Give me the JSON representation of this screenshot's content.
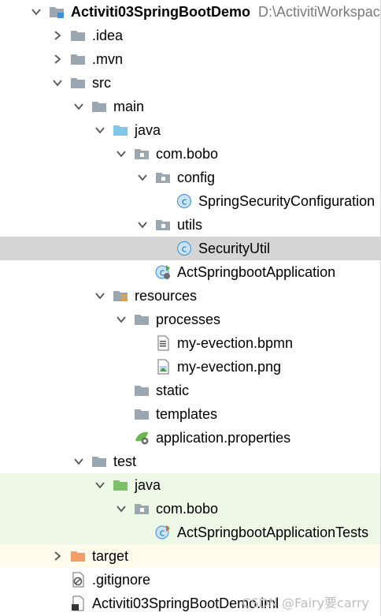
{
  "project": {
    "name": "Activiti03SpringBootDemo",
    "path": "D:\\ActivitiWorkspac"
  },
  "tree": [
    {
      "label": "Activiti03SpringBootDemo",
      "indent": 0,
      "arrow": "down",
      "icon": "module-folder-icon",
      "bold": true
    },
    {
      "label": ".idea",
      "indent": 1,
      "arrow": "right",
      "icon": "folder-icon"
    },
    {
      "label": ".mvn",
      "indent": 1,
      "arrow": "right",
      "icon": "folder-icon"
    },
    {
      "label": "src",
      "indent": 1,
      "arrow": "down",
      "icon": "folder-icon"
    },
    {
      "label": "main",
      "indent": 2,
      "arrow": "down",
      "icon": "folder-icon"
    },
    {
      "label": "java",
      "indent": 3,
      "arrow": "down",
      "icon": "source-folder-icon"
    },
    {
      "label": "com.bobo",
      "indent": 4,
      "arrow": "down",
      "icon": "package-icon"
    },
    {
      "label": "config",
      "indent": 5,
      "arrow": "down",
      "icon": "package-icon"
    },
    {
      "label": "SpringSecurityConfiguration",
      "indent": 6,
      "arrow": "none",
      "icon": "class-icon"
    },
    {
      "label": "utils",
      "indent": 5,
      "arrow": "down",
      "icon": "package-icon"
    },
    {
      "label": "SecurityUtil",
      "indent": 6,
      "arrow": "none",
      "icon": "class-icon",
      "selected": true
    },
    {
      "label": "ActSpringbootApplication",
      "indent": 5,
      "arrow": "none",
      "icon": "spring-boot-class-icon"
    },
    {
      "label": "resources",
      "indent": 3,
      "arrow": "down",
      "icon": "resources-folder-icon"
    },
    {
      "label": "processes",
      "indent": 4,
      "arrow": "down",
      "icon": "folder-icon"
    },
    {
      "label": "my-evection.bpmn",
      "indent": 5,
      "arrow": "none",
      "icon": "text-file-icon"
    },
    {
      "label": "my-evection.png",
      "indent": 5,
      "arrow": "none",
      "icon": "image-file-icon"
    },
    {
      "label": "static",
      "indent": 4,
      "arrow": "none",
      "icon": "folder-icon"
    },
    {
      "label": "templates",
      "indent": 4,
      "arrow": "none",
      "icon": "folder-icon"
    },
    {
      "label": "application.properties",
      "indent": 4,
      "arrow": "none",
      "icon": "spring-properties-icon"
    },
    {
      "label": "test",
      "indent": 2,
      "arrow": "down",
      "icon": "folder-icon"
    },
    {
      "label": "java",
      "indent": 3,
      "arrow": "down",
      "icon": "test-source-folder-icon",
      "test": true
    },
    {
      "label": "com.bobo",
      "indent": 4,
      "arrow": "down",
      "icon": "package-icon",
      "test": true
    },
    {
      "label": "ActSpringbootApplicationTests",
      "indent": 5,
      "arrow": "none",
      "icon": "spring-boot-test-class-icon",
      "test": true
    },
    {
      "label": "target",
      "indent": 1,
      "arrow": "right",
      "icon": "excluded-folder-icon",
      "ignored": true
    },
    {
      "label": ".gitignore",
      "indent": 1,
      "arrow": "none",
      "icon": "gitignore-file-icon"
    },
    {
      "label": "Activiti03SpringBootDemo.iml",
      "indent": 1,
      "arrow": "none",
      "icon": "iml-file-icon"
    }
  ],
  "watermark": "CSDN @Fairy要carry",
  "colors": {
    "folder": "#9aa7b0",
    "source_folder": "#7fc6e8",
    "test_folder": "#7cc16a",
    "excluded_folder": "#f29e66",
    "selection": "#d5d5d5",
    "test_background": "#eef8e6",
    "ignored_background": "#fffcee"
  }
}
